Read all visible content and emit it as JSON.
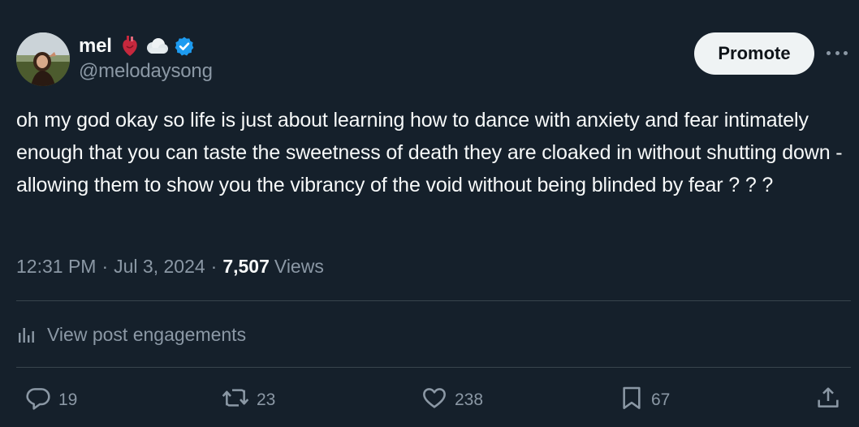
{
  "author": {
    "display_name": "mel",
    "handle": "@melodaysong",
    "badges": [
      "anatomical-heart-emoji",
      "cloud-emoji",
      "verified-badge-icon"
    ]
  },
  "header": {
    "promote_label": "Promote",
    "more_icon": "more-horizontal-icon"
  },
  "tweet": {
    "text": "oh my god okay so life is just about learning how to dance with anxiety and fear intimately enough that you can taste the sweetness of death they are cloaked in without shutting down - allowing them to show you the vibrancy of the void without being blinded by fear ? ? ?",
    "time": "12:31 PM",
    "separator": "·",
    "date": "Jul 3, 2024",
    "views_count": "7,507",
    "views_label": "Views"
  },
  "engagements": {
    "label": "View post engagements",
    "icon": "analytics-bars-icon"
  },
  "actions": {
    "replies": "19",
    "reposts": "23",
    "likes": "238",
    "bookmarks": "67"
  },
  "colors": {
    "background": "#15202b",
    "primary_text": "#f7f9f9",
    "secondary_text": "#8b98a5",
    "verified_blue": "#1d9bf0",
    "divider": "#38444d",
    "promote_bg": "#eff3f4"
  }
}
